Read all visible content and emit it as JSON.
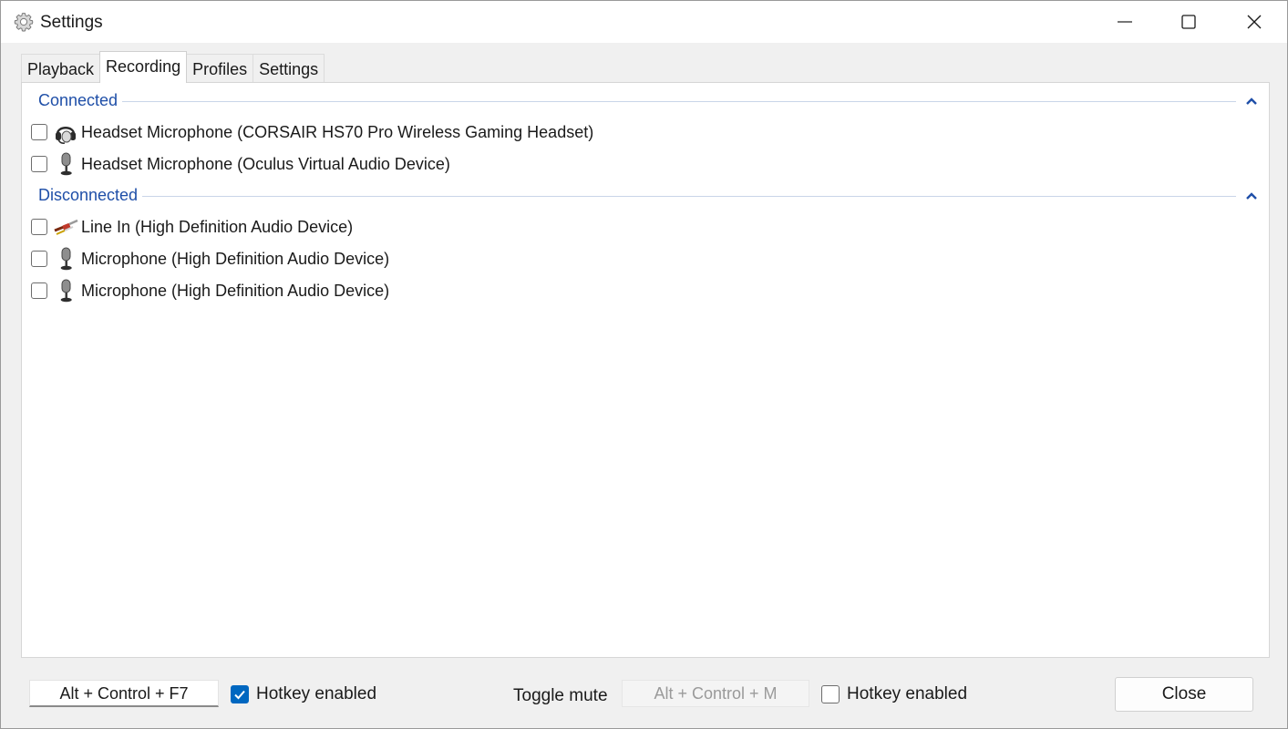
{
  "window": {
    "title": "Settings",
    "app_icon": "gear-icon"
  },
  "tabs": [
    {
      "label": "Playback",
      "active": false
    },
    {
      "label": "Recording",
      "active": true
    },
    {
      "label": "Profiles",
      "active": false
    },
    {
      "label": "Settings",
      "active": false
    }
  ],
  "groups": {
    "connected": {
      "label": "Connected",
      "devices": [
        {
          "label": "Headset Microphone (CORSAIR HS70 Pro Wireless Gaming Headset)",
          "icon": "headset-icon",
          "checked": false
        },
        {
          "label": "Headset Microphone (Oculus Virtual Audio Device)",
          "icon": "microphone-icon",
          "checked": false
        }
      ]
    },
    "disconnected": {
      "label": "Disconnected",
      "devices": [
        {
          "label": "Line In (High Definition Audio Device)",
          "icon": "line-in-cable-icon",
          "checked": false
        },
        {
          "label": "Microphone (High Definition Audio Device)",
          "icon": "microphone-icon",
          "checked": false
        },
        {
          "label": "Microphone (High Definition Audio Device)",
          "icon": "microphone-icon",
          "checked": false
        }
      ]
    }
  },
  "footer": {
    "hotkey1": "Alt + Control + F7",
    "hotkey1_enabled_label": "Hotkey enabled",
    "hotkey1_enabled": true,
    "toggle_label": "Toggle mute",
    "hotkey2": "Alt + Control + M",
    "hotkey2_enabled_label": "Hotkey enabled",
    "hotkey2_enabled": false,
    "close_label": "Close"
  },
  "colors": {
    "accent": "#0067c0",
    "group_header": "#1f4fa8"
  }
}
